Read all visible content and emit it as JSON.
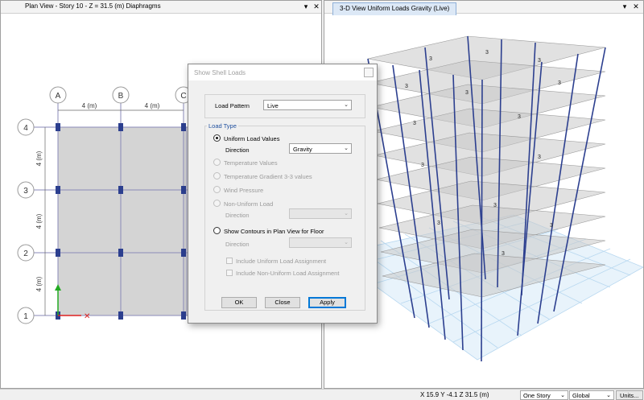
{
  "left_pane": {
    "title": "Plan View - Story 10 - Z = 31.5 (m)  Diaphragms",
    "grid_cols": [
      "A",
      "B",
      "C"
    ],
    "grid_rows": [
      "4",
      "3",
      "2",
      "1"
    ],
    "col_spacing": "4 (m)",
    "row_spacing": "4 (m)"
  },
  "right_pane": {
    "title": "3-D View  Uniform Loads Gravity  (Live)",
    "load_value": "3"
  },
  "window_buttons": {
    "menu": "▾",
    "close": "✕"
  },
  "dialog": {
    "title": "Show Shell Loads",
    "load_pattern_label": "Load Pattern",
    "load_pattern_value": "Live",
    "load_type_label": "Load Type",
    "options": [
      "Uniform  Load  Values",
      "Temperature Values",
      "Temperature Gradient 3-3 values",
      "Wind Pressure",
      "Non-Uniform Load",
      "Show Contours in Plan View for Floor"
    ],
    "direction_label": "Direction",
    "direction_value": "Gravity",
    "include_uniform": "Include Uniform Load Assignment",
    "include_nonuniform": "Include Non-Uniform Load Assignment",
    "ok": "OK",
    "close": "Close",
    "apply": "Apply"
  },
  "status": {
    "coords": "X 15.9  Y -4.1  Z 31.5 (m)",
    "story_mode": "One Story",
    "coord_system": "Global",
    "units_button": "Units..."
  },
  "colors": {
    "column": "#2c3f8f",
    "slab": "#d4d4d4",
    "accent": "#0078d7"
  }
}
